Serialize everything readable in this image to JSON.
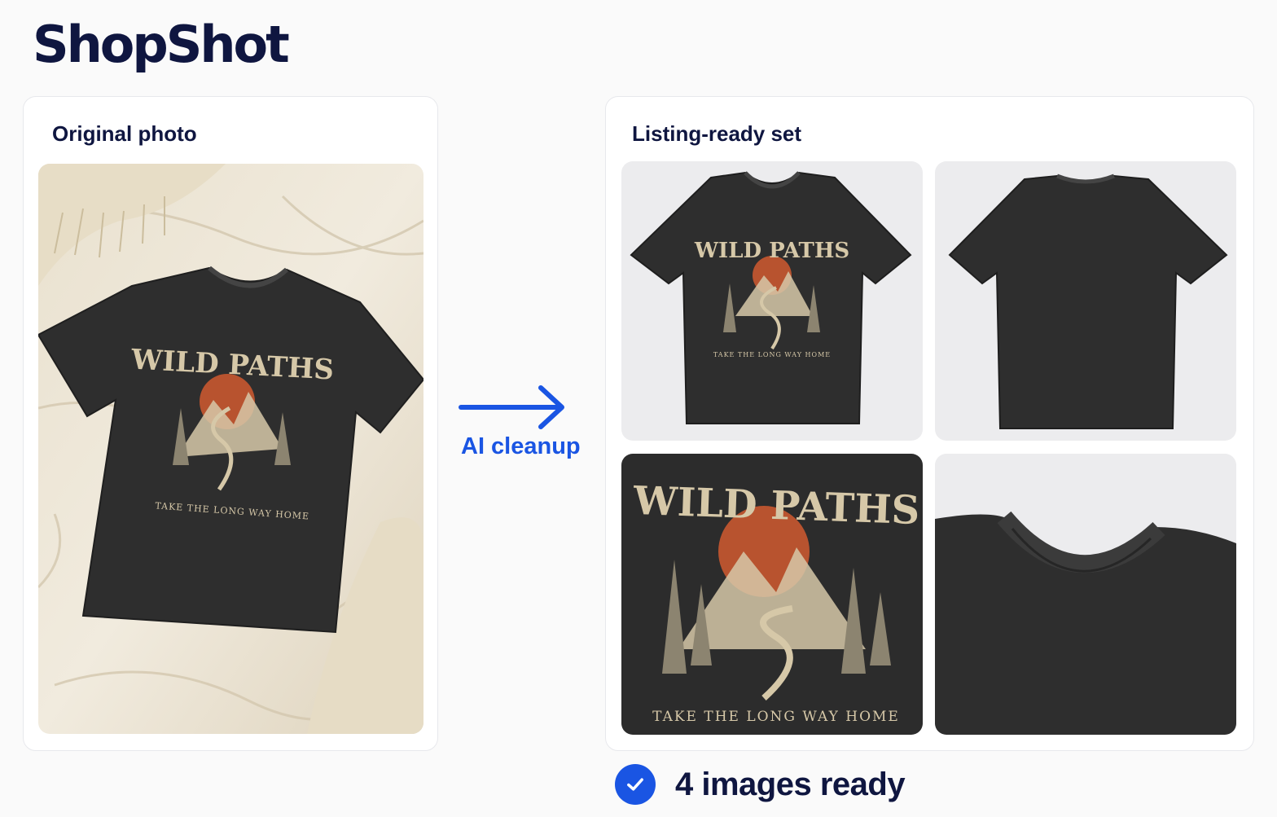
{
  "app": {
    "name": "ShopShot"
  },
  "original": {
    "title": "Original photo",
    "photo_icon": "tshirt-on-bed-photo"
  },
  "process": {
    "label": "AI cleanup",
    "icon": "arrow-right-icon"
  },
  "listing": {
    "title": "Listing-ready set",
    "images": [
      {
        "name": "front-view",
        "icon": "tshirt-front-photo"
      },
      {
        "name": "back-view",
        "icon": "tshirt-back-photo"
      },
      {
        "name": "graphic-closeup",
        "icon": "graphic-detail-photo"
      },
      {
        "name": "collar-closeup",
        "icon": "collar-detail-photo"
      }
    ]
  },
  "graphic": {
    "headline": "WILD PATHS",
    "tagline": "TAKE THE LONG WAY HOME"
  },
  "status": {
    "text": "4 images ready",
    "icon": "check-circle-icon"
  },
  "colors": {
    "brand_blue": "#1a55e3",
    "navy_text": "#0f1640",
    "shirt": "#2b2b2b",
    "print_cream": "#d6c8a8",
    "sun_orange": "#c0552f"
  }
}
